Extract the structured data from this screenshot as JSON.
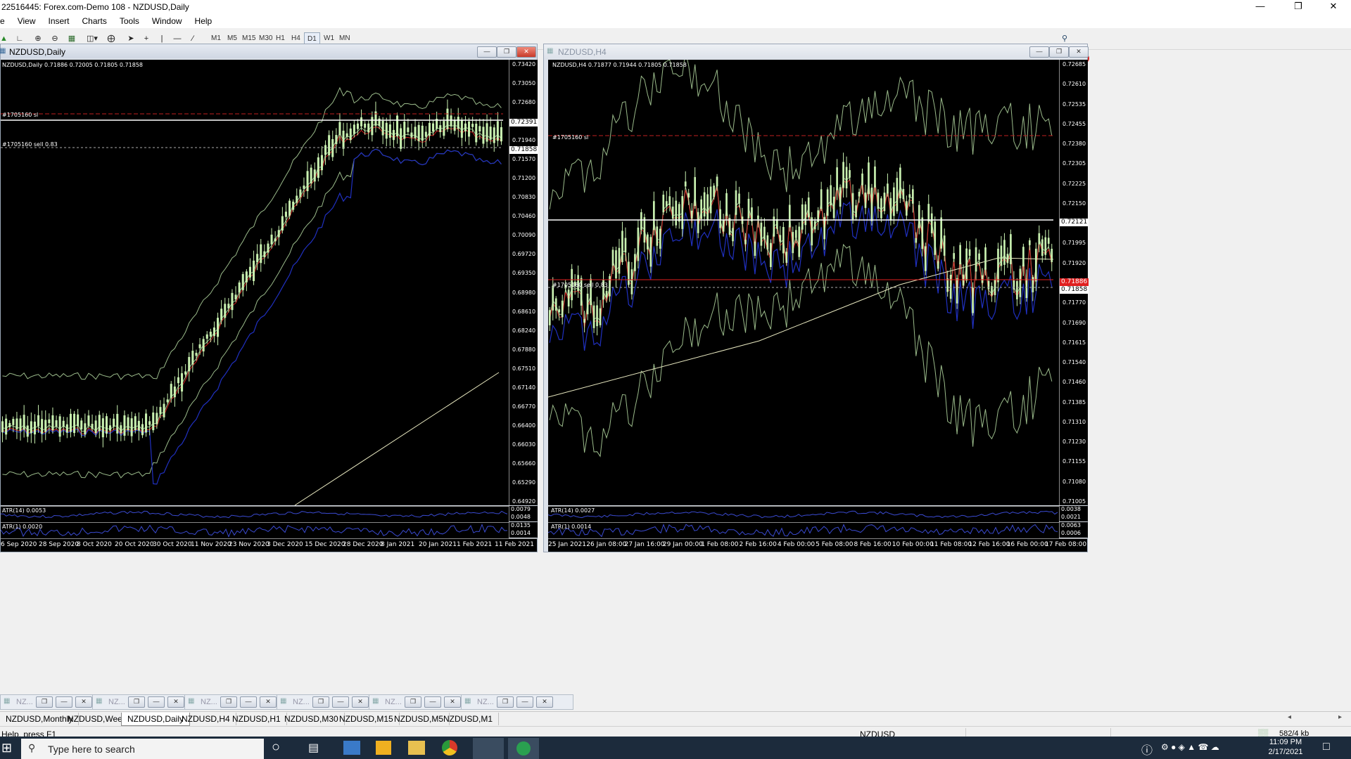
{
  "window": {
    "title": "22516445: Forex.com-Demo 108 - NZDUSD,Daily"
  },
  "menu": [
    "e",
    "View",
    "Insert",
    "Charts",
    "Tools",
    "Window",
    "Help"
  ],
  "toolbar": {
    "timeframes": [
      "M1",
      "M5",
      "M15",
      "M30",
      "H1",
      "H4",
      "D1",
      "W1",
      "MN"
    ],
    "active": "D1",
    "alert_count": "1"
  },
  "left_chart": {
    "window_title": "NZDUSD,Daily",
    "info": "NZDUSD,Daily  0.71886 0.72005 0.71805 0.71858",
    "sl_label": "#1705160 sl",
    "sell_label": "#1705160 sell 0.83",
    "price_labels": [
      "0.73420",
      "0.73050",
      "0.72680",
      "0.72310",
      "0.71940",
      "0.71570",
      "0.71200",
      "0.70830",
      "0.70460",
      "0.70090",
      "0.69720",
      "0.69350",
      "0.68980",
      "0.68610",
      "0.68240",
      "0.67880",
      "0.67510",
      "0.67140",
      "0.66770",
      "0.66400",
      "0.66030",
      "0.65660",
      "0.65290",
      "0.64920"
    ],
    "sl_price": "0.72391",
    "bid_price": "0.71858",
    "atr14": "ATR(14) 0.0053",
    "atr14_scale": [
      "0.0079",
      "0.0048"
    ],
    "atr1": "ATR(1) 0.0020",
    "atr1_scale": [
      "0.0135",
      "0.0014"
    ],
    "dates": [
      "6 Sep 2020",
      "28 Sep 2020",
      "8 Oct 2020",
      "20 Oct 2020",
      "30 Oct 2020",
      "11 Nov 2020",
      "23 Nov 2020",
      "3 Dec 2020",
      "15 Dec 2020",
      "28 Dec 2020",
      "8 Jan 2021",
      "20 Jan 2021",
      "1 Feb 2021",
      "11 Feb 2021"
    ]
  },
  "right_chart": {
    "window_title": "NZDUSD,H4",
    "info": "NZDUSD,H4  0.71877 0.71944 0.71805 0.71858",
    "sl_label": "#1705160 sl",
    "sell_label": "#1705160 sell 0.83",
    "price_labels": [
      "0.72685",
      "0.72610",
      "0.72535",
      "0.72455",
      "0.72380",
      "0.72305",
      "0.72225",
      "0.72150",
      "0.72075",
      "0.71995",
      "0.71920",
      "0.71845",
      "0.71770",
      "0.71690",
      "0.71615",
      "0.71540",
      "0.71460",
      "0.71385",
      "0.71310",
      "0.71230",
      "0.71155",
      "0.71080",
      "0.71005"
    ],
    "line_price": "0.72121",
    "red_price": "0.71886",
    "bid_price": "0.71858",
    "atr14": "ATR(14) 0.0027",
    "atr14_scale": [
      "0.0038",
      "0.0021"
    ],
    "atr1": "ATR(1) 0.0014",
    "atr1_scale": [
      "0.0063",
      "0.0006"
    ],
    "dates": [
      "25 Jan 2021",
      "26 Jan 08:00",
      "27 Jan 16:00",
      "29 Jan 00:00",
      "1 Feb 08:00",
      "2 Feb 16:00",
      "4 Feb 00:00",
      "5 Feb 08:00",
      "8 Feb 16:00",
      "10 Feb 00:00",
      "11 Feb 08:00",
      "12 Feb 16:00",
      "16 Feb 00:00",
      "17 Feb 08:00"
    ]
  },
  "minimized": [
    "NZ...",
    "NZ...",
    "NZ...",
    "NZ...",
    "NZ...",
    "NZ..."
  ],
  "tabs": [
    "NZDUSD,Monthly",
    "NZDUSD,Weekly",
    "NZDUSD,Daily",
    "NZDUSD,H4",
    "NZDUSD,H1",
    "NZDUSD,M30",
    "NZDUSD,M15",
    "NZDUSD,M5",
    "NZDUSD,M1"
  ],
  "active_tab": "NZDUSD,Daily",
  "status": {
    "help": "Help, press F1",
    "profile": "NZDUSD",
    "traffic": "582/4 kb"
  },
  "taskbar": {
    "search_placeholder": "Type here to search",
    "time": "11:09 PM",
    "date": "2/17/2021"
  },
  "colors": {
    "bull_candle": "#c8f0b0",
    "ma_red": "#d02020",
    "ma_blue": "#2030c0",
    "bands": "#9aba8a",
    "ma_long": "#e8e8c0"
  }
}
